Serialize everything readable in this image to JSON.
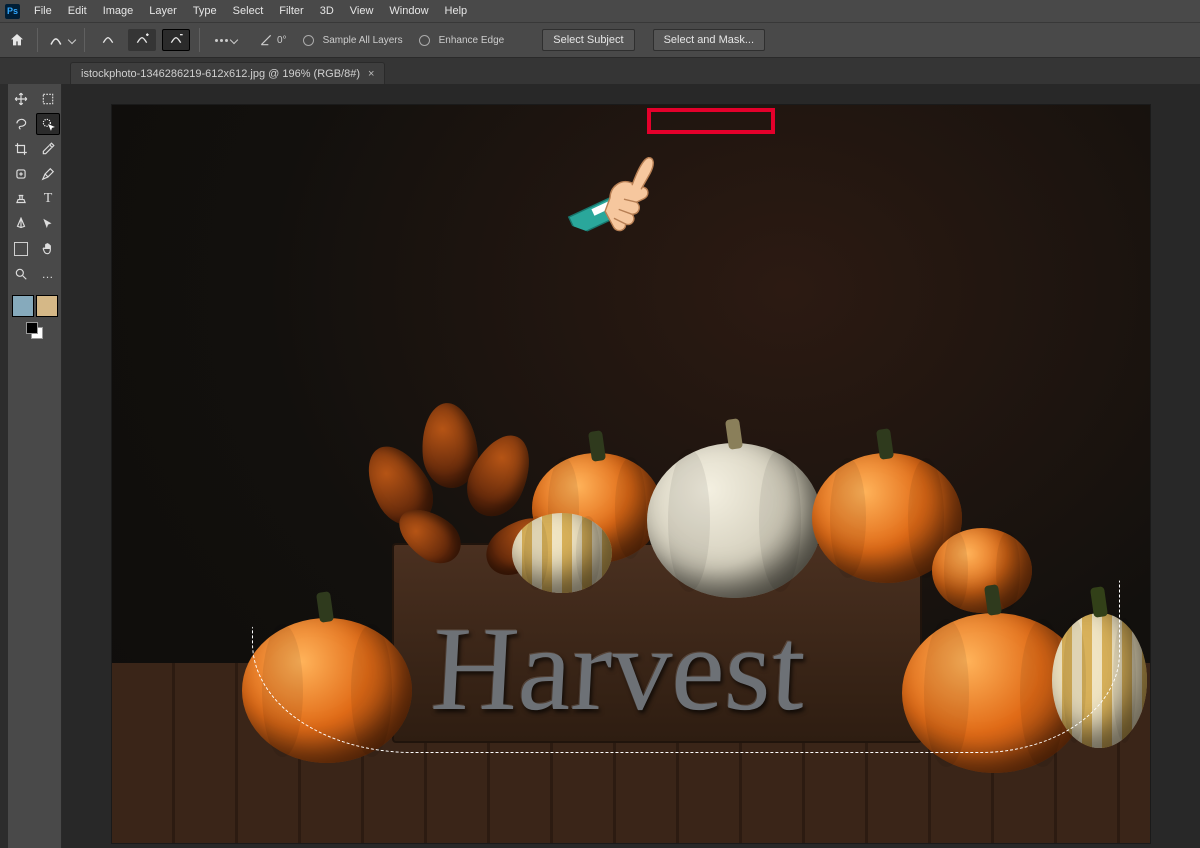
{
  "app": {
    "logo_text": "Ps"
  },
  "menu": [
    "File",
    "Edit",
    "Image",
    "Layer",
    "Type",
    "Select",
    "Filter",
    "3D",
    "View",
    "Window",
    "Help"
  ],
  "options": {
    "angle_value": "0°",
    "sample_all_layers": "Sample All Layers",
    "enhance_edge": "Enhance Edge",
    "select_subject": "Select Subject",
    "select_and_mask": "Select and Mask..."
  },
  "document": {
    "tab_label": "istockphoto-1346286219-612x612.jpg @ 196% (RGB/8#)"
  },
  "canvas": {
    "sign_text": "Harvest"
  },
  "tool_icons": {
    "home": "home-icon",
    "brush_mode": "brush-mode-icon",
    "new_sel": "new-selection-icon",
    "add_sel": "add-to-selection-icon",
    "sub_sel": "subtract-from-selection-icon",
    "angle": "angle-icon",
    "dots": "brush-preset-icon",
    "move": "move-icon",
    "marquee": "marquee-icon",
    "lasso": "lasso-icon",
    "quick_select": "quick-select-icon",
    "crop": "crop-icon",
    "eyedrop": "eyedropper-icon",
    "heal": "healing-brush-icon",
    "brush": "brush-icon",
    "stamp": "clone-stamp-icon",
    "eraser": "eraser-icon",
    "gradient": "gradient-icon",
    "type": "type-icon",
    "pen": "pen-icon",
    "path": "path-select-icon",
    "frame": "frame-icon",
    "hand": "hand-icon",
    "zoom": "zoom-icon",
    "more": "edit-toolbar-icon",
    "close": "close-icon"
  }
}
